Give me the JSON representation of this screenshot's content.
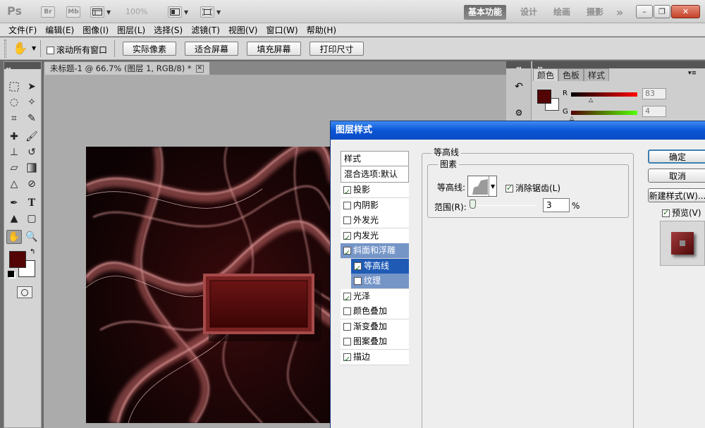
{
  "app": {
    "logo": "Ps",
    "bridge_label": "Br",
    "minibridge_label": "Mb",
    "zoom_level": "100%",
    "workspaces": [
      "基本功能",
      "设计",
      "绘画",
      "摄影"
    ],
    "more_workspaces": "»",
    "window_controls": {
      "minimize": "–",
      "restore": "❐",
      "close": "✕"
    }
  },
  "menu": [
    "文件(F)",
    "编辑(E)",
    "图像(I)",
    "图层(L)",
    "选择(S)",
    "滤镜(T)",
    "视图(V)",
    "窗口(W)",
    "帮助(H)"
  ],
  "options_bar": {
    "scroll_all_label": "滚动所有窗口",
    "scroll_all_checked": false,
    "buttons": [
      "实际像素",
      "适合屏幕",
      "填充屏幕",
      "打印尺寸"
    ]
  },
  "document": {
    "tab_title": "未标题-1 @ 66.7% (图层 1, RGB/8) *",
    "close_glyph": "✕"
  },
  "color_panel": {
    "tabs": [
      "颜色",
      "色板",
      "样式"
    ],
    "r_label": "R",
    "r_value": "83",
    "g_label": "G",
    "g_value": "4",
    "foreground_color": "#530404",
    "background_color": "#ffffff"
  },
  "dialog": {
    "title": "图层样式",
    "styles_header": "样式",
    "blend_options": "混合选项:默认",
    "effects": [
      {
        "label": "投影",
        "checked": true
      },
      {
        "label": "内阴影",
        "checked": false
      },
      {
        "label": "外发光",
        "checked": false
      },
      {
        "label": "内发光",
        "checked": true
      },
      {
        "label": "斜面和浮雕",
        "checked": true
      },
      {
        "label": "等高线",
        "checked": true
      },
      {
        "label": "纹理",
        "checked": false
      },
      {
        "label": "光泽",
        "checked": true
      },
      {
        "label": "颜色叠加",
        "checked": false
      },
      {
        "label": "渐变叠加",
        "checked": false
      },
      {
        "label": "图案叠加",
        "checked": false
      },
      {
        "label": "描边",
        "checked": true
      }
    ],
    "section_title": "等高线",
    "group_title": "图素",
    "contour_label": "等高线:",
    "antialias_label": "消除锯齿(L)",
    "antialias_checked": true,
    "range_label": "范围(R):",
    "range_value": "3",
    "range_unit": "%",
    "range_fraction": 0.03,
    "ok_label": "确定",
    "cancel_label": "取消",
    "new_style_label": "新建样式(W)...",
    "preview_label": "预览(V)",
    "preview_checked": true
  },
  "colors": {
    "accent_blue": "#0a56d6",
    "selection_blue": "#7595c7",
    "swatch_red": "#530404"
  }
}
